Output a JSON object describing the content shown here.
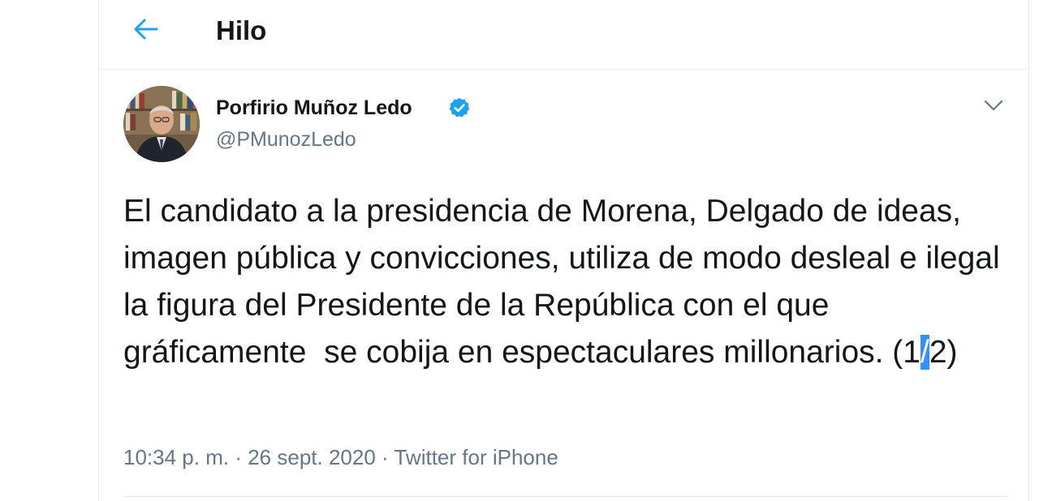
{
  "header": {
    "title": "Hilo",
    "back_icon": "arrow-left-icon"
  },
  "tweet": {
    "author_name": "Porfirio Muñoz Ledo",
    "handle": "@PMunozLedo",
    "verified": true,
    "text_before_selection": "El candidato a la presidencia de Morena, Delgado de ideas, imagen pública y convicciones, utiliza de modo desleal e ilegal la figura del Presidente de la República con el que gráficamente  se cobija en espectaculares millonarios. (1",
    "text_selected": "/",
    "text_after_selection": "2)",
    "time": "10:34 p. m.",
    "separator": "·",
    "date": "26 sept. 2020",
    "source": "Twitter for iPhone"
  },
  "colors": {
    "accent": "#1da1f2",
    "text": "#14171a",
    "secondary": "#657786",
    "border": "#e6ecf0",
    "selection": "#3390ff"
  }
}
